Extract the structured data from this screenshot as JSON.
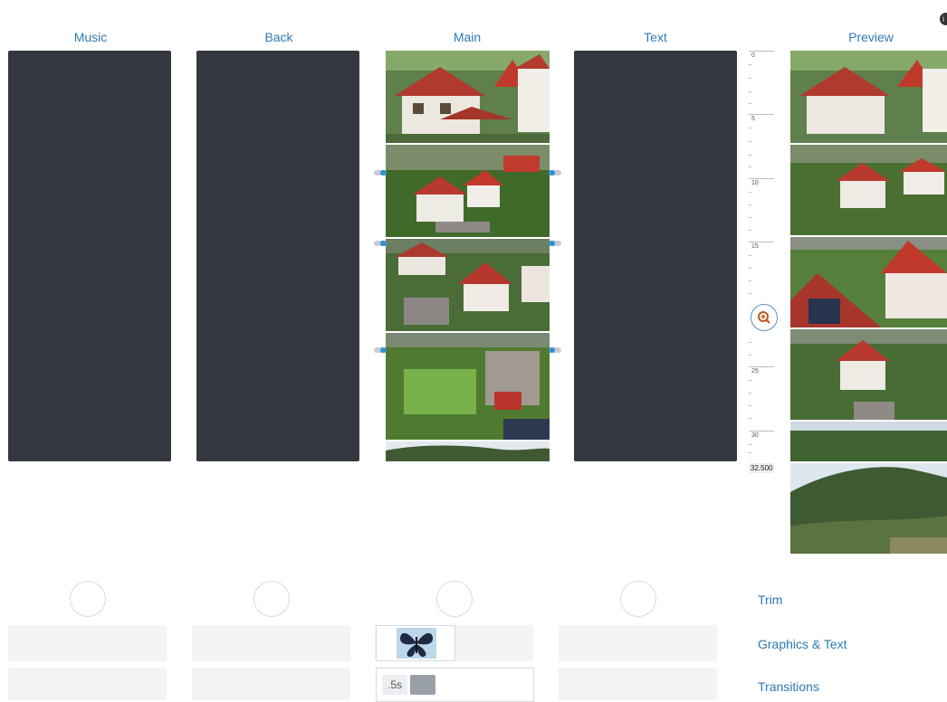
{
  "columns": {
    "music": "Music",
    "back": "Back",
    "main": "Main",
    "text": "Text",
    "preview": "Preview"
  },
  "ruler": {
    "ticks": [
      "0",
      "5",
      "10",
      "15",
      "25",
      "30"
    ],
    "end_value": "32.500"
  },
  "main_panel": {
    "duration": ".5s"
  },
  "side_menu": {
    "trim": "Trim",
    "graphics_text": "Graphics & Text",
    "transitions": "Transitions"
  },
  "colors": {
    "accent": "#2e79b3",
    "track_bg": "#323740",
    "handle_dot": "#2f93d6"
  }
}
